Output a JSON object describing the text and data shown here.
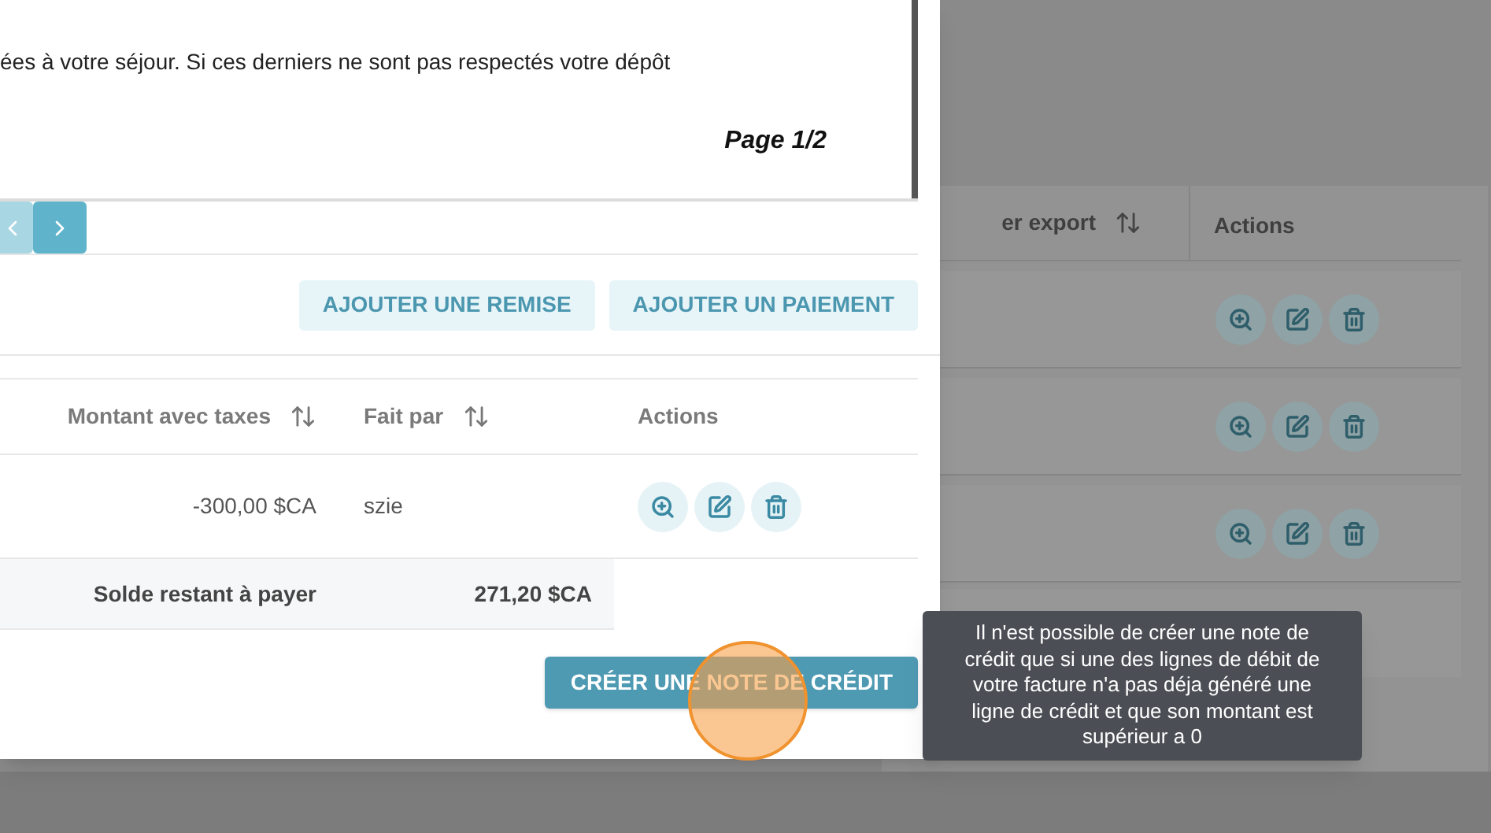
{
  "background_table": {
    "columns": [
      "er export",
      "Actions"
    ],
    "rows": [
      {
        "actions": [
          {
            "kind": "view"
          },
          {
            "kind": "edit"
          },
          {
            "kind": "delete"
          }
        ]
      },
      {
        "actions": [
          {
            "kind": "view"
          },
          {
            "kind": "edit"
          },
          {
            "kind": "delete"
          }
        ]
      },
      {
        "actions": [
          {
            "kind": "view"
          },
          {
            "kind": "edit"
          },
          {
            "kind": "delete"
          }
        ]
      }
    ]
  },
  "modal": {
    "document": {
      "text": "ées à votre séjour. Si ces derniers ne sont pas respectés votre dépôt",
      "page": "Page 1/2"
    },
    "pagination": [
      {
        "kind": "prev",
        "disabled": true
      },
      {
        "kind": "next",
        "disabled": false
      }
    ],
    "buttons": [
      "AJOUTER UNE REMISE",
      "AJOUTER UN PAIEMENT"
    ],
    "table": {
      "columns": [
        {
          "label": "Montant avec taxes",
          "sortable": true
        },
        {
          "label": "Fait par",
          "sortable": true
        },
        {
          "label": "Actions",
          "sortable": false
        }
      ],
      "rows": [
        {
          "amount": "-300,00 $CA",
          "by": "szie",
          "actions": [
            {
              "kind": "view"
            },
            {
              "kind": "edit"
            },
            {
              "kind": "delete"
            }
          ]
        }
      ],
      "total": {
        "label": "Solde restant à payer",
        "value": "271,20 $CA"
      }
    },
    "primary_button": "CRÉER UNE NOTE DE CRÉDIT"
  },
  "tooltip": "Il n'est possible de créer une note de crédit que si une des lignes de débit de votre facture n'a pas déja généré une ligne de crédit et que son montant est supérieur a 0"
}
